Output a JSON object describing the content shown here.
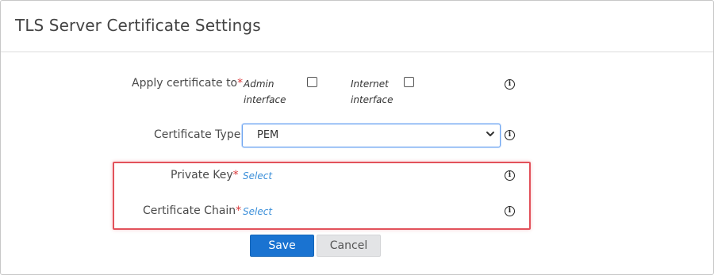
{
  "dialog": {
    "title": "TLS Server Certificate Settings"
  },
  "form": {
    "apply_to": {
      "label": "Apply certificate to",
      "required_mark": "*",
      "options": [
        {
          "line1": "Admin",
          "line2": "interface",
          "checked": false
        },
        {
          "line1": "Internet",
          "line2": "interface",
          "checked": false
        }
      ]
    },
    "cert_type": {
      "label": "Certificate Type",
      "value": "PEM"
    },
    "private_key": {
      "label": "Private Key",
      "required_mark": "*",
      "link": "Select"
    },
    "cert_chain": {
      "label": "Certificate Chain",
      "required_mark": "*",
      "link": "Select"
    },
    "info_glyph": "i"
  },
  "buttons": {
    "save": "Save",
    "cancel": "Cancel"
  },
  "colors": {
    "primary": "#1a73d1",
    "required": "#d9383a",
    "link": "#3b8fd9",
    "highlight": "#e2525b"
  }
}
